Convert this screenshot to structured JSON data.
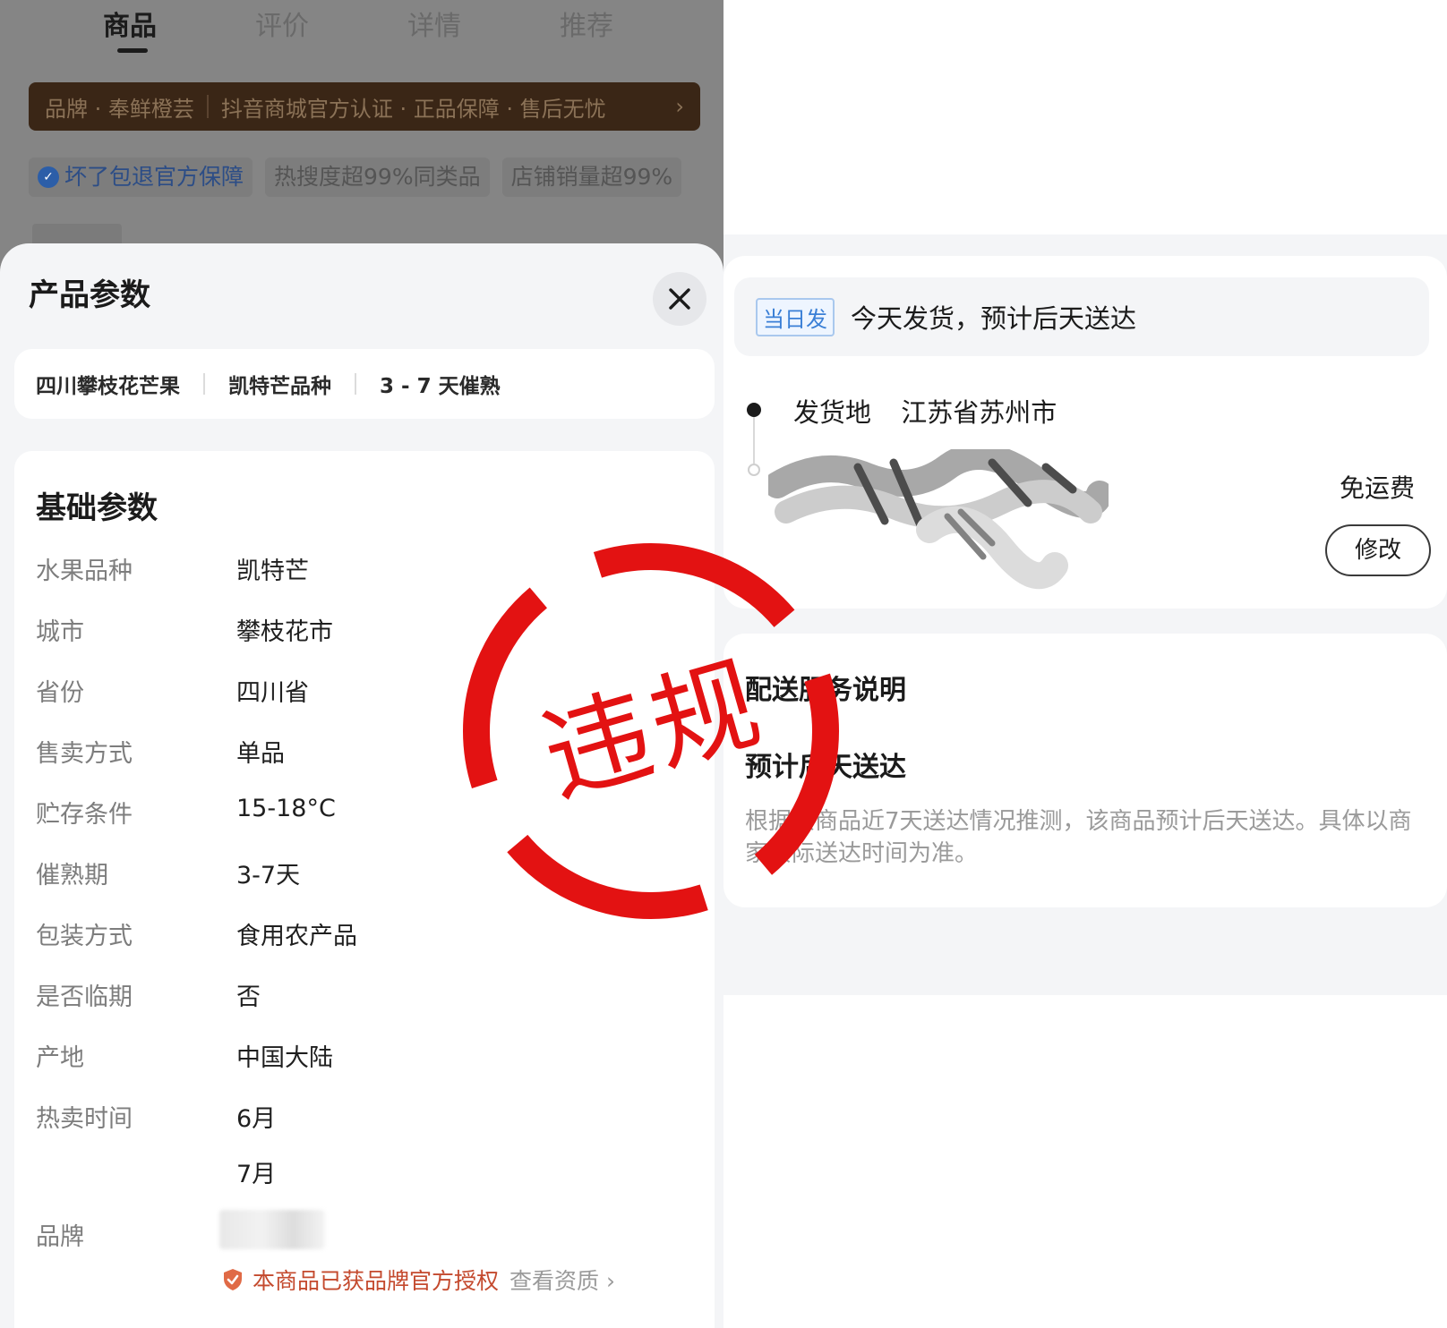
{
  "left": {
    "tabs": [
      {
        "label": "商品",
        "active": true
      },
      {
        "label": "评价",
        "active": false
      },
      {
        "label": "详情",
        "active": false
      },
      {
        "label": "推荐",
        "active": false
      }
    ],
    "brand_bar": {
      "brand": "品牌 · 奉鲜橙芸",
      "cert": "抖音商城官方认证 · 正品保障 · 售后无忧",
      "chevron": "›"
    },
    "badges": [
      "坏了包退官方保障",
      "热搜度超99%同类品",
      "店铺销量超99%"
    ],
    "sheet": {
      "title": "产品参数",
      "close_icon": "close-icon",
      "tags": [
        "四川攀枝花芒果",
        "凯特芒品种",
        "3 - 7 天催熟"
      ],
      "basic_title": "基础参数",
      "params": [
        {
          "label": "水果品种",
          "value": "凯特芒"
        },
        {
          "label": "城市",
          "value": "攀枝花市"
        },
        {
          "label": "省份",
          "value": "四川省"
        },
        {
          "label": "售卖方式",
          "value": "单品"
        },
        {
          "label": "贮存条件",
          "value": "15-18°C"
        },
        {
          "label": "催熟期",
          "value": "3-7天"
        },
        {
          "label": "包装方式",
          "value": "食用农产品"
        },
        {
          "label": "是否临期",
          "value": "否"
        },
        {
          "label": "产地",
          "value": "中国大陆"
        },
        {
          "label": "热卖时间",
          "value": "6月"
        },
        {
          "label": "",
          "value": "7月"
        },
        {
          "label": "品牌",
          "value": ""
        }
      ],
      "auth_text": "本商品已获品牌官方授权",
      "auth_link": "查看资质 ›"
    }
  },
  "right": {
    "same_day_tag": "当日发",
    "ship_text": "今天发货，预计后天送达",
    "origin_label": "发货地",
    "origin_value": "江苏省苏州市",
    "free_shipping": "免运费",
    "modify_label": "修改",
    "service_title": "配送服务说明",
    "service_sub": "预计后天送达",
    "service_desc": "根据该商品近7天送达情况推测，该商品预计后天送达。具体以商家实际送达时间为准。"
  },
  "stamp": {
    "text": "违规",
    "color": "#e31212"
  },
  "colors": {
    "accent_blue": "#3a7fd6",
    "auth_orange": "#c44a2e",
    "brand_bar_bg": "#3a2616"
  }
}
